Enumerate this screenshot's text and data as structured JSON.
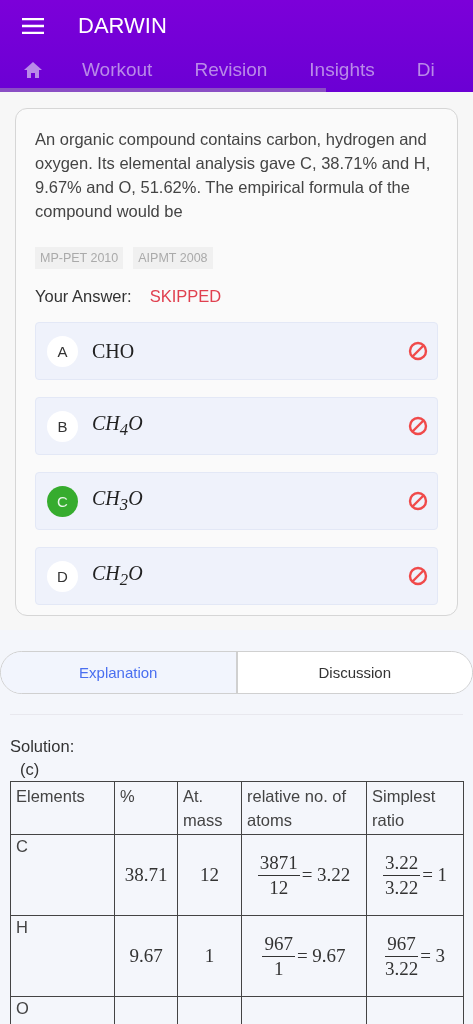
{
  "app_bar": {
    "title": "DARWIN"
  },
  "nav_tabs": [
    {
      "kind": "home",
      "selected": false
    },
    {
      "kind": "text",
      "label": "Workout",
      "selected": false
    },
    {
      "kind": "text",
      "label": "Revision",
      "selected": false
    },
    {
      "kind": "text",
      "label": "Insights",
      "selected": false
    },
    {
      "kind": "text",
      "label": "Di",
      "selected": false
    }
  ],
  "progress": {
    "level": 0.69
  },
  "question": {
    "text": "An organic compound contains carbon, hydrogen and oxygen. Its elemental analysis gave C, 38.71% and H, 9.67% and O, 51.62%. The empirical formula of the compound would be",
    "tags": [
      "MP-PET 2010",
      "AIPMT 2008"
    ],
    "answer_label": "Your Answer:",
    "answer_value": "SKIPPED",
    "options": [
      {
        "letter": "A",
        "formula": "CHO",
        "italic": false,
        "correct": false,
        "skipped": true
      },
      {
        "letter": "B",
        "formula": "CH$_{4}$O",
        "italic": true,
        "correct": false,
        "skipped": true
      },
      {
        "letter": "C",
        "formula": "CH$_{3}$O",
        "italic": true,
        "correct": true,
        "skipped": true
      },
      {
        "letter": "D",
        "formula": "CH$_{2}$O",
        "italic": true,
        "correct": false,
        "skipped": true
      }
    ]
  },
  "segments": [
    {
      "label": "Explanation",
      "selected": true
    },
    {
      "label": "Discussion",
      "selected": false
    }
  ],
  "solution": {
    "heading": "Solution:",
    "answer": "(c)",
    "table": {
      "columns": [
        "Elements",
        "%",
        "At. mass",
        "relative no. of atoms",
        "Simplest ratio"
      ],
      "rows": [
        [
          {
            "kind": "text",
            "text": "C"
          },
          {
            "kind": "num",
            "text": "38.71"
          },
          {
            "kind": "num",
            "text": "12"
          },
          {
            "kind": "fraction",
            "numerator": "3871",
            "denominator": "12",
            "result": "= 3.22"
          },
          {
            "kind": "fraction",
            "numerator": "3.22",
            "denominator": "3.22",
            "result": "= 1"
          }
        ],
        [
          {
            "kind": "text",
            "text": "H"
          },
          {
            "kind": "num",
            "text": "9.67"
          },
          {
            "kind": "num",
            "text": "1"
          },
          {
            "kind": "fraction",
            "numerator": "967",
            "denominator": "1",
            "result": "= 9.67"
          },
          {
            "kind": "fraction",
            "numerator": "967",
            "denominator": "3.22",
            "result": "= 3"
          }
        ],
        [
          {
            "kind": "text",
            "text": "O"
          }
        ]
      ]
    }
  }
}
